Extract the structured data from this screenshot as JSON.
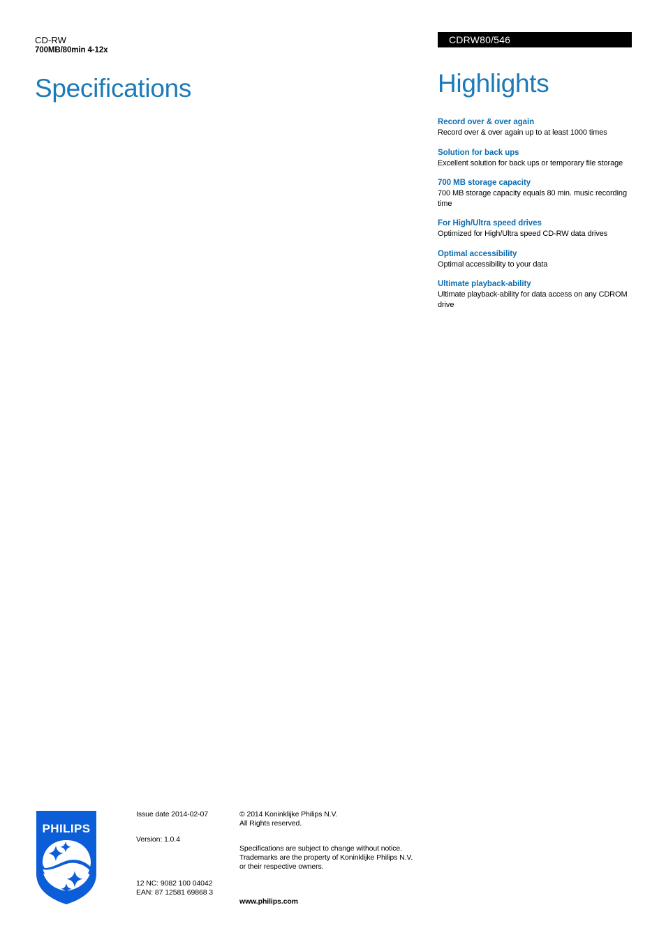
{
  "document": {
    "product_name": "CD-RW",
    "product_variant": "700MB/80min 4-12x",
    "product_code": "CDRW80/546",
    "specifications_title": "Specifications",
    "highlights_title": "Highlights"
  },
  "colors": {
    "title_blue": "#1b7ab8",
    "heading_blue": "#0e6db0",
    "banner_bg": "#000000",
    "banner_text": "#ffffff",
    "philips_blue": "#0b5ed7",
    "body_text": "#000000"
  },
  "highlights": [
    {
      "heading": "Record over & over again",
      "text": "Record over & over again up to at least 1000 times"
    },
    {
      "heading": "Solution for back ups",
      "text": "Excellent solution for back ups or temporary file storage"
    },
    {
      "heading": "700 MB storage capacity",
      "text": "700 MB storage capacity equals 80 min. music recording time"
    },
    {
      "heading": "For High/Ultra speed drives",
      "text": "Optimized for High/Ultra speed CD-RW data drives"
    },
    {
      "heading": "Optimal accessibility",
      "text": "Optimal accessibility to your data"
    },
    {
      "heading": "Ultimate playback-ability",
      "text": "Ultimate playback-ability for data access on any CDROM drive"
    }
  ],
  "footer": {
    "logo_wordmark": "PHILIPS",
    "issue_date": "Issue date 2014-02-07",
    "version": "Version: 1.0.4",
    "twelve_nc": "12 NC: 9082 100 04042",
    "ean": "EAN: 87 12581 69868 3",
    "copyright_line1": "© 2014 Koninklijke Philips N.V.",
    "copyright_line2": "All Rights reserved.",
    "notice_line1": "Specifications are subject to change without notice.",
    "notice_line2": "Trademarks are the property of Koninklijke Philips N.V.",
    "notice_line3": "or their respective owners.",
    "website": "www.philips.com"
  }
}
